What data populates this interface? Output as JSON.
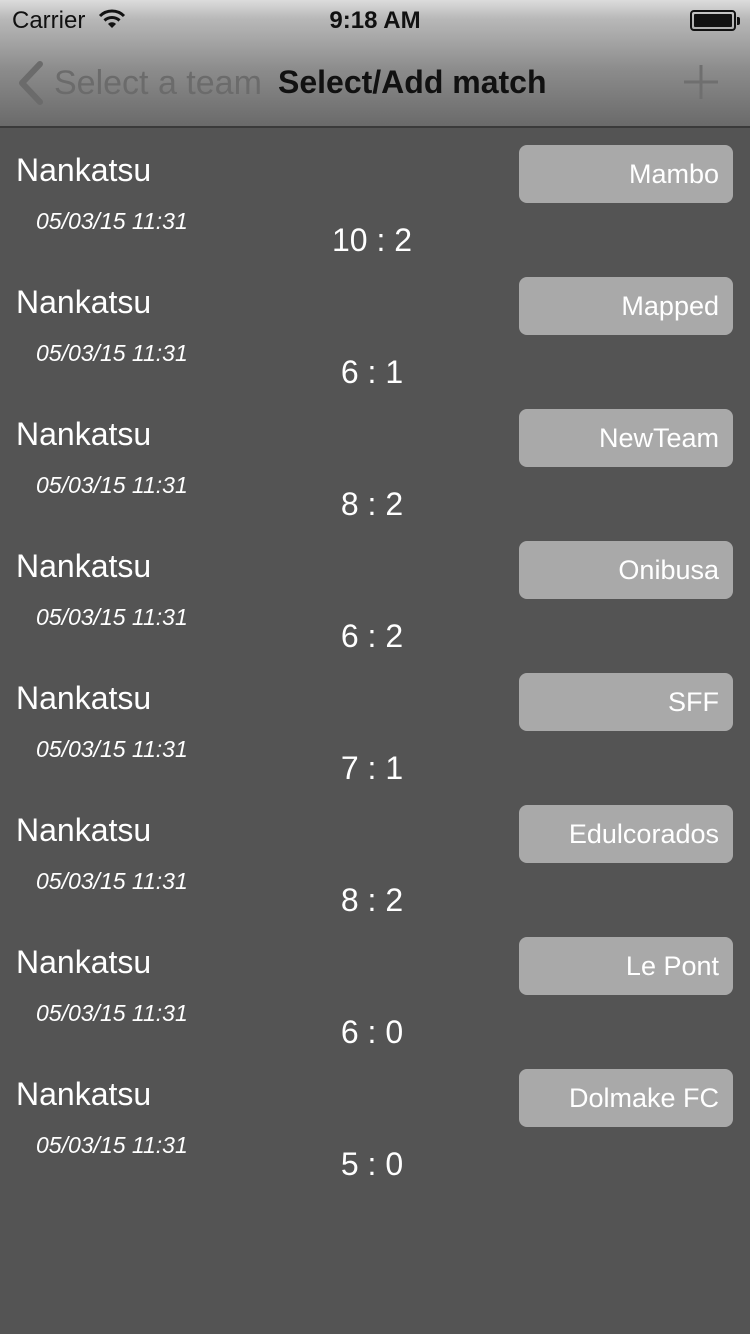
{
  "status_bar": {
    "carrier": "Carrier",
    "time": "9:18 AM"
  },
  "nav": {
    "back_label": "Select a team",
    "title": "Select/Add match",
    "back_icon": "chevron-left-icon",
    "add_icon": "plus-icon"
  },
  "matches": [
    {
      "team": "Nankatsu",
      "date": "05/03/15 11:31",
      "score": "10 : 2",
      "opponent": "Mambo"
    },
    {
      "team": "Nankatsu",
      "date": "05/03/15 11:31",
      "score": "6 : 1",
      "opponent": "Mapped"
    },
    {
      "team": "Nankatsu",
      "date": "05/03/15 11:31",
      "score": "8 : 2",
      "opponent": "NewTeam"
    },
    {
      "team": "Nankatsu",
      "date": "05/03/15 11:31",
      "score": "6 : 2",
      "opponent": "Onibusa"
    },
    {
      "team": "Nankatsu",
      "date": "05/03/15 11:31",
      "score": "7 : 1",
      "opponent": "SFF"
    },
    {
      "team": "Nankatsu",
      "date": "05/03/15 11:31",
      "score": "8 : 2",
      "opponent": "Edulcorados"
    },
    {
      "team": "Nankatsu",
      "date": "05/03/15 11:31",
      "score": "6 : 0",
      "opponent": "Le Pont"
    },
    {
      "team": "Nankatsu",
      "date": "05/03/15 11:31",
      "score": "5 : 0",
      "opponent": "Dolmake FC"
    }
  ],
  "colors": {
    "background": "#545454",
    "opponent_button": "#a9a9a9",
    "text": "#ffffff"
  }
}
